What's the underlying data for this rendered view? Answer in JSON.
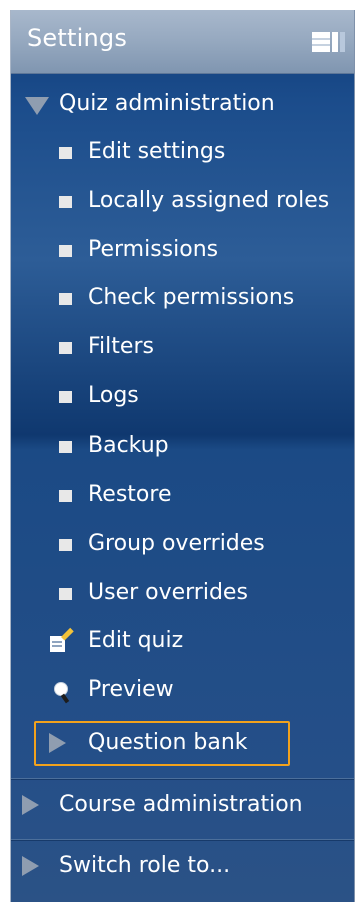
{
  "header": {
    "title": "Settings",
    "dock_icon": "dock-icon"
  },
  "quiz_admin": {
    "label": "Quiz administration",
    "expanded": true,
    "items": [
      {
        "label": "Edit settings",
        "icon": "bullet-icon"
      },
      {
        "label": "Locally assigned roles",
        "icon": "bullet-icon"
      },
      {
        "label": "Permissions",
        "icon": "bullet-icon"
      },
      {
        "label": "Check permissions",
        "icon": "bullet-icon"
      },
      {
        "label": "Filters",
        "icon": "bullet-icon"
      },
      {
        "label": "Logs",
        "icon": "bullet-icon"
      },
      {
        "label": "Backup",
        "icon": "bullet-icon"
      },
      {
        "label": "Restore",
        "icon": "bullet-icon"
      },
      {
        "label": "Group overrides",
        "icon": "bullet-icon"
      },
      {
        "label": "User overrides",
        "icon": "bullet-icon"
      }
    ],
    "edit_quiz": {
      "label": "Edit quiz",
      "icon": "edit-icon"
    },
    "preview": {
      "label": "Preview",
      "icon": "search-icon"
    },
    "question_bank": {
      "label": "Question bank",
      "icon": "expand-arrow-icon",
      "highlighted": true
    }
  },
  "course_admin": {
    "label": "Course administration",
    "icon": "expand-arrow-icon"
  },
  "switch_role": {
    "label": "Switch role to...",
    "icon": "expand-arrow-icon"
  },
  "colors": {
    "panel": "#1b4c8b",
    "header": "#95a8bf",
    "highlight": "#f2a21d",
    "text": "#ffffff"
  }
}
